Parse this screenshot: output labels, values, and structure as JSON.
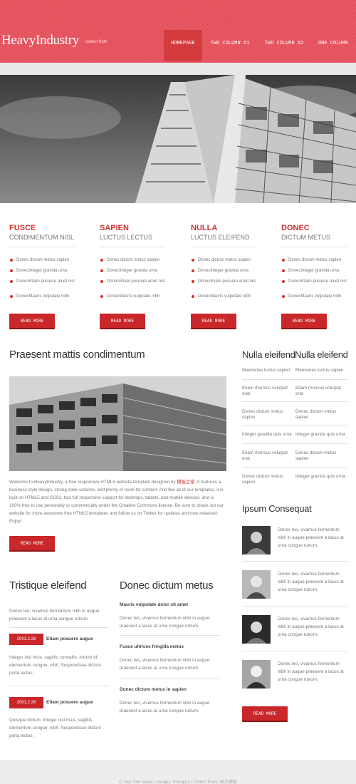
{
  "header": {
    "logo": "HeavyIndustry",
    "logo_sub": "collect from",
    "nav": [
      "HOMEPAGE",
      "TWO COLUMN #1",
      "TWO COLUMN #2",
      "ONE COLUMN"
    ],
    "accent_color": "#e8525d",
    "active_color": "#d43b3d"
  },
  "features": [
    {
      "title": "FUSCE",
      "subtitle": "CONDIMENTUM NISL",
      "items": [
        "Donec dictum metus sapien",
        "DonecInteger gravida urna",
        "DonecEtiam posuere amet nisl",
        "DonecMauris vulputate nibh"
      ],
      "button": "READ MORE"
    },
    {
      "title": "SAPIEN",
      "subtitle": "LUCTUS LECTUS",
      "items": [
        "Donec dictum metus sapien",
        "DonecInteger gravida urna",
        "DonecEtiam posuere amet nisl",
        "DonecMauris vulputate nibh"
      ],
      "button": "READ MORE"
    },
    {
      "title": "NULLA",
      "subtitle": "LUCTUS ELEIFEND",
      "items": [
        "Donec dictum metus sapien",
        "DonecInteger gravida urna",
        "DonecEtiam posuere amet nisl",
        "DonecMauris vulputate nibh"
      ],
      "button": "READ MORE"
    },
    {
      "title": "DONEC",
      "subtitle": "DICTUM METUS",
      "items": [
        "Donec dictum metus sapien",
        "DonecInteger gravida urna",
        "DonecEtiam posuere amet nisl",
        "DonecMauris vulputate nibh"
      ],
      "button": "READ MORE"
    }
  ],
  "main": {
    "title": "Praesent mattis condimentum",
    "para_1": "Welcome to HeavyIndustry, a free responsive HTML5 website template designed by ",
    "para_link": "模板之家",
    "para_2": ". It features a business style design, strong color scheme, and plenty of room for content. And like all of our templates, it is built on HTML5 and CSS3, has full responsive support for desktops, tablets, and mobile devices, and is 100% free to use personally or commercially under the Creative Commons license. Be sure to check out our website for more awesome free HTML5 templates and follow us on Twitter for updates and new releases! Enjoy!",
    "button": "READ MORE"
  },
  "tristique": {
    "title": "Tristique eleifend",
    "intro": "Donec leo, vivamus fermentum nibh in augue praesent a lacus at urna congue rutrum.",
    "posts": [
      {
        "date": "2001.2.26",
        "heading": "Etiam posuere augue",
        "text": "Integer nisl risus, sagittis convallis, rutrum id, elementum congue, nibh. Suspendisse dictum porta lectus."
      },
      {
        "date": "2001.2.26",
        "heading": "Etiam posuere augue",
        "text": "Quisque dictum. Integer nisl risus, sagittis elementum congue, nibh. Suspendisse dictum porta lectus."
      }
    ]
  },
  "donec": {
    "title": "Donec dictum metus",
    "items": [
      {
        "heading": "Mauris vulputate dolor sit amet",
        "text": "Donec leo, vivamus fermentum nibh in augue praesent a lacus at urna congue rutrum."
      },
      {
        "heading": "Fusce ultrices fringilla metus",
        "text": "Donec leo, vivamus fermentum nibh in augue praesent a lacus at urna congue rutrum."
      },
      {
        "heading": "Donec dictum metus in sapien",
        "text": "Donec leo, vivamus fermentum nibh in augue praesent a lacus at urna congue rutrum."
      }
    ]
  },
  "sidebar": {
    "title_a": "Nulla eleifend",
    "title_b": "Nulla eleifend",
    "col_a": [
      "Maecenas luctus sapien",
      "Etiam rhoncus volutpat erat",
      "Donec dictum metus sapien",
      "Integer gravida quis urna",
      "Etiam rhoncus volutpat erat",
      "Donec dictum metus sapien"
    ],
    "col_b": [
      "Maecenas luctus sapien",
      "Etiam rhoncus volutpat erat",
      "Donec dictum metus sapien",
      "Integer gravida quis urna",
      "Donec dictum metus sapien",
      "Integer gravida quis urna"
    ],
    "ipsum_title": "Ipsum Consequat",
    "testimonials": [
      "Donec leo, vivamus fermentum nibh in augue praesent a lacus at urna congue rutrum.",
      "Donec leo, vivamus fermentum nibh in augue praesent a lacus at urna congue rutrum.",
      "Donec leo, vivamus fermentum nibh in augue praesent a lacus at urna congue rutrum.",
      "Donec leo, vivamus fermentum nibh in augue praesent a lacus at urna congue rutrum."
    ],
    "button": "READ MORE"
  },
  "footer": {
    "text": "© Your Site Name | Images: Fotogrph | Collect From: 网页模板"
  }
}
